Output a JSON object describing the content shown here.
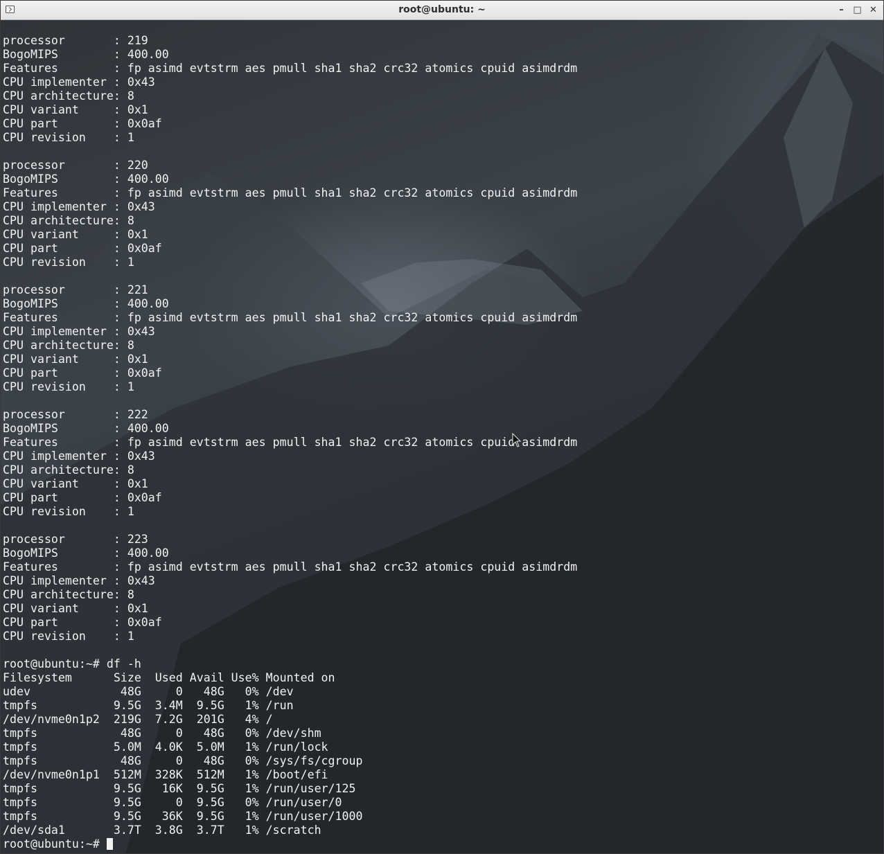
{
  "window": {
    "title": "root@ubuntu: ~",
    "controls": {
      "minimize": "–",
      "maximize": "□",
      "close": "✕"
    }
  },
  "terminal": {
    "lines": [
      "processor       : 219",
      "BogoMIPS        : 400.00",
      "Features        : fp asimd evtstrm aes pmull sha1 sha2 crc32 atomics cpuid asimdrdm",
      "CPU implementer : 0x43",
      "CPU architecture: 8",
      "CPU variant     : 0x1",
      "CPU part        : 0x0af",
      "CPU revision    : 1",
      "",
      "processor       : 220",
      "BogoMIPS        : 400.00",
      "Features        : fp asimd evtstrm aes pmull sha1 sha2 crc32 atomics cpuid asimdrdm",
      "CPU implementer : 0x43",
      "CPU architecture: 8",
      "CPU variant     : 0x1",
      "CPU part        : 0x0af",
      "CPU revision    : 1",
      "",
      "processor       : 221",
      "BogoMIPS        : 400.00",
      "Features        : fp asimd evtstrm aes pmull sha1 sha2 crc32 atomics cpuid asimdrdm",
      "CPU implementer : 0x43",
      "CPU architecture: 8",
      "CPU variant     : 0x1",
      "CPU part        : 0x0af",
      "CPU revision    : 1",
      "",
      "processor       : 222",
      "BogoMIPS        : 400.00",
      "Features        : fp asimd evtstrm aes pmull sha1 sha2 crc32 atomics cpuid asimdrdm",
      "CPU implementer : 0x43",
      "CPU architecture: 8",
      "CPU variant     : 0x1",
      "CPU part        : 0x0af",
      "CPU revision    : 1",
      "",
      "processor       : 223",
      "BogoMIPS        : 400.00",
      "Features        : fp asimd evtstrm aes pmull sha1 sha2 crc32 atomics cpuid asimdrdm",
      "CPU implementer : 0x43",
      "CPU architecture: 8",
      "CPU variant     : 0x1",
      "CPU part        : 0x0af",
      "CPU revision    : 1",
      "",
      "root@ubuntu:~# df -h",
      "Filesystem      Size  Used Avail Use% Mounted on",
      "udev             48G     0   48G   0% /dev",
      "tmpfs           9.5G  3.4M  9.5G   1% /run",
      "/dev/nvme0n1p2  219G  7.2G  201G   4% /",
      "tmpfs            48G     0   48G   0% /dev/shm",
      "tmpfs           5.0M  4.0K  5.0M   1% /run/lock",
      "tmpfs            48G     0   48G   0% /sys/fs/cgroup",
      "/dev/nvme0n1p1  512M  328K  512M   1% /boot/efi",
      "tmpfs           9.5G   16K  9.5G   1% /run/user/125",
      "tmpfs           9.5G     0  9.5G   0% /run/user/0",
      "tmpfs           9.5G   36K  9.5G   1% /run/user/1000",
      "/dev/sda1       3.7T  3.8G  3.7T   1% /scratch"
    ],
    "prompt": "root@ubuntu:~# "
  }
}
